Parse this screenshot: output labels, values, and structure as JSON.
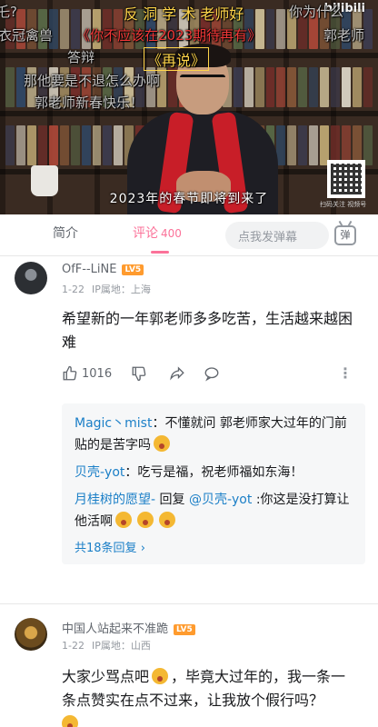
{
  "video": {
    "watermark": "bilibili",
    "subtitle": "2023年的春节即将到来了",
    "qr_caption": "扫码关注 视频号",
    "danmaku": [
      {
        "text": "乇?",
        "style": "pale"
      },
      {
        "text": "反 洞 学 术 老师好",
        "style": "yellow"
      },
      {
        "text": "你为什么",
        "style": "pale"
      },
      {
        "text": "衣冠禽兽",
        "style": "pale"
      },
      {
        "text": "《你不应该在2023期待再有》",
        "style": "red"
      },
      {
        "text": "郭老师",
        "style": "pale"
      },
      {
        "text": "答辩",
        "style": "pale"
      },
      {
        "text": "《再说》",
        "style": "hl"
      },
      {
        "text": "那他要是不退怎么办啊",
        "style": "pale"
      },
      {
        "text": "郭老师新春快乐！",
        "style": "pale"
      }
    ]
  },
  "tabs": {
    "intro": "简介",
    "comments": "评论",
    "comments_count": "400",
    "danmu_placeholder": "点我发弹幕",
    "danmu_toggle": "弹"
  },
  "comments": [
    {
      "username": "OfF--LiNE",
      "level": "LV5",
      "date": "1-22",
      "ip": "IP属地：上海",
      "text": "希望新的一年郭老师多多吃苦，生活越来越困难",
      "likes": "1016",
      "replies": [
        {
          "name": "Magic丶mist",
          "text": "：不懂就问 郭老师家大过年的门前贴的是苦字吗"
        },
        {
          "name": "贝壳-yot",
          "text": "：吃亏是福，祝老师福如东海！"
        },
        {
          "name": "月桂树的愿望-",
          "text": " 回复 ",
          "mention": "@贝壳-yot",
          "text2": " :你这是没打算让他活啊"
        }
      ],
      "more_replies": "共18条回复"
    },
    {
      "username": "中国人站起来不准跪",
      "level": "LV5",
      "date": "1-22",
      "ip": "IP属地：山西",
      "text_a": "大家少骂点吧",
      "text_b": "，毕竟大过年的，我一条一条点赞实在点不过来，让我放个假行吗？"
    }
  ]
}
